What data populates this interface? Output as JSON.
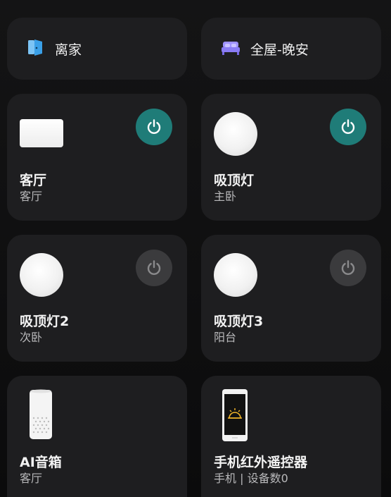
{
  "scenes": [
    {
      "label": "离家",
      "icon": "door-icon"
    },
    {
      "label": "全屋-晚安",
      "icon": "bed-icon"
    }
  ],
  "devices": [
    {
      "name": "客厅",
      "room": "客厅",
      "icon": "light-panel-icon",
      "power": "on"
    },
    {
      "name": "吸顶灯",
      "room": "主卧",
      "icon": "ceiling-lamp-icon",
      "power": "on"
    },
    {
      "name": "吸顶灯2",
      "room": "次卧",
      "icon": "ceiling-lamp-icon",
      "power": "off"
    },
    {
      "name": "吸顶灯3",
      "room": "阳台",
      "icon": "ceiling-lamp-icon",
      "power": "off"
    },
    {
      "name": "AI音箱",
      "room": "客厅",
      "icon": "speaker-icon"
    },
    {
      "name": "手机红外遥控器",
      "room": "手机 | 设备数0",
      "icon": "phone-remote-icon"
    }
  ],
  "colors": {
    "power_on": "#1f7c78",
    "power_off": "#3b3b3d",
    "card_bg": "#1e1e20",
    "door_blue": "#3aa0e8",
    "bed_purple": "#8a7cf4"
  }
}
